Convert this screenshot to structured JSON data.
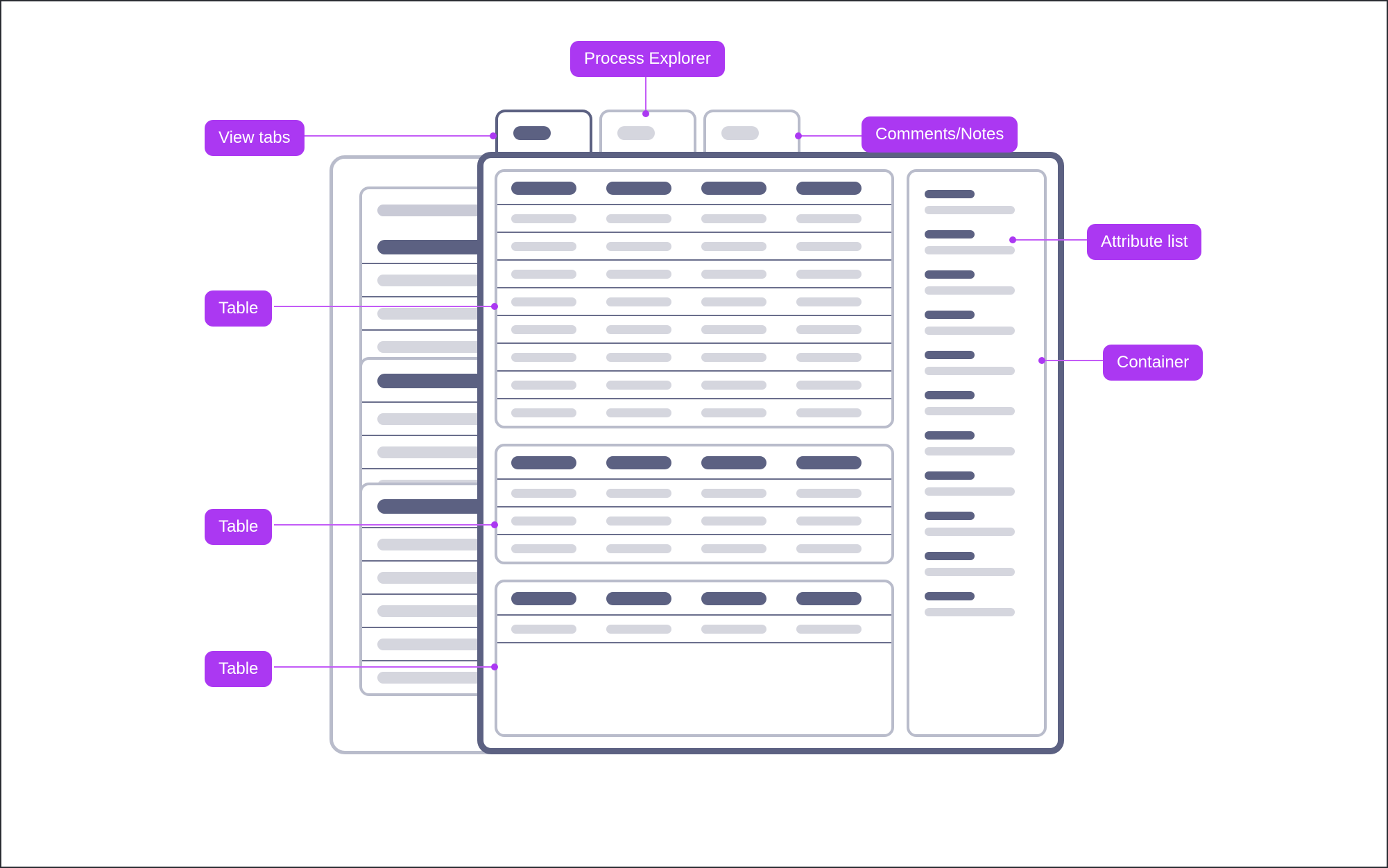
{
  "diagram": {
    "title": "UI wireframe annotation diagram",
    "accent_color": "#ab38f2",
    "connector_color": "#c35cf7",
    "dark_ui_color": "#5c6182",
    "light_ui_color": "#b9bccb",
    "skeleton_bar_color": "#d5d6de",
    "row_divider_color": "#6a6e8c"
  },
  "annotations": [
    {
      "id": "process-explorer",
      "label": "Process Explorer"
    },
    {
      "id": "view-tabs",
      "label": "View tabs"
    },
    {
      "id": "comments-notes",
      "label": "Comments/Notes"
    },
    {
      "id": "attribute-list",
      "label": "Attribute list"
    },
    {
      "id": "container",
      "label": "Container"
    },
    {
      "id": "table-1",
      "label": "Table"
    },
    {
      "id": "table-2",
      "label": "Table"
    },
    {
      "id": "table-3",
      "label": "Table"
    }
  ],
  "tabs": [
    {
      "id": "tab-1",
      "active": true,
      "state": "selected"
    },
    {
      "id": "tab-2",
      "active": false,
      "state": "unselected"
    },
    {
      "id": "tab-3",
      "active": false,
      "state": "unselected"
    }
  ],
  "main_tables": [
    {
      "id": "main-table-1",
      "columns": 4,
      "header_row": true,
      "data_rows": 8,
      "filler": false
    },
    {
      "id": "main-table-2",
      "columns": 4,
      "header_row": true,
      "data_rows": 3,
      "filler": false
    },
    {
      "id": "main-table-3",
      "columns": 4,
      "header_row": true,
      "data_rows": 1,
      "filler": true
    }
  ],
  "attribute_list": {
    "id": "attribute-list-panel",
    "item_count": 11
  },
  "background_tables": [
    {
      "id": "bg-table-1",
      "header_variant": "light",
      "rows": 5
    },
    {
      "id": "bg-table-2",
      "header_variant": "dark",
      "rows": 4
    },
    {
      "id": "bg-table-3",
      "header_variant": "dark",
      "rows": 5
    }
  ]
}
